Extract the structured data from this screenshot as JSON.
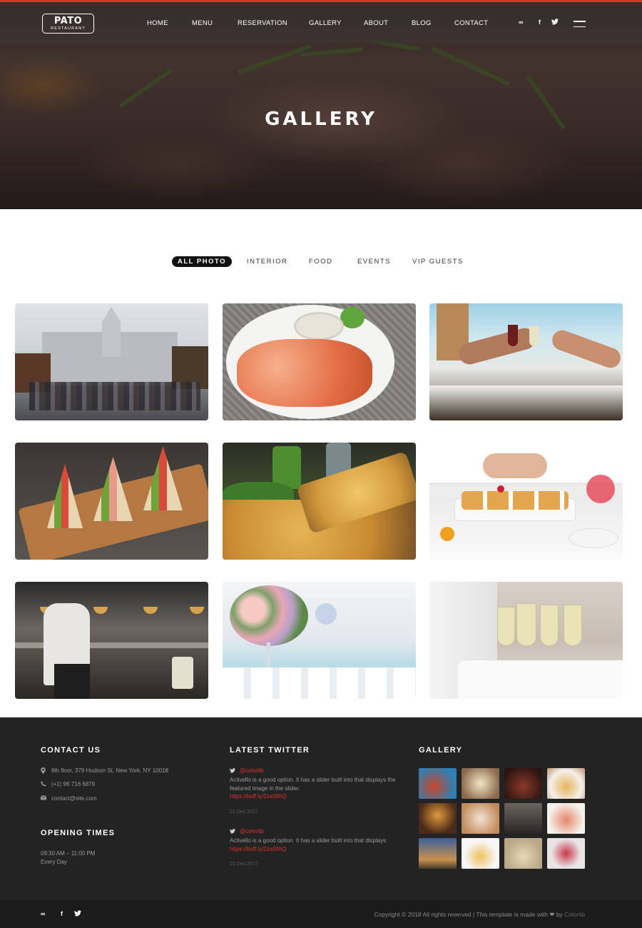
{
  "brand": {
    "name": "PATO",
    "tagline": "RESTAURANT"
  },
  "nav": {
    "items": [
      {
        "label": "HOME"
      },
      {
        "label": "MENU"
      },
      {
        "label": "RESERVATION"
      },
      {
        "label": "GALLERY"
      },
      {
        "label": "ABOUT"
      },
      {
        "label": "BLOG"
      },
      {
        "label": "CONTACT"
      }
    ],
    "social": [
      {
        "icon": "tripadvisor-icon",
        "glyph": "∞"
      },
      {
        "icon": "facebook-icon",
        "glyph": "f"
      },
      {
        "icon": "twitter-icon",
        "glyph": "✓"
      }
    ]
  },
  "hero": {
    "title": "GALLERY"
  },
  "filters": [
    {
      "label": "ALL PHOTO",
      "active": true
    },
    {
      "label": "INTERIOR",
      "active": false
    },
    {
      "label": "FOOD",
      "active": false
    },
    {
      "label": "EVENTS",
      "active": false
    },
    {
      "label": "VIP GUESTS",
      "active": false
    }
  ],
  "gallery": [
    {
      "subject": "christmas-market-street"
    },
    {
      "subject": "grilled-shrimp-plate"
    },
    {
      "subject": "wine-toast-table"
    },
    {
      "subject": "sandwiches-on-board"
    },
    {
      "subject": "pizza-slice"
    },
    {
      "subject": "dessert-tartlets"
    },
    {
      "subject": "chef-in-kitchen"
    },
    {
      "subject": "wedding-flower-centerpiece"
    },
    {
      "subject": "champagne-glasses-tray"
    }
  ],
  "footer": {
    "contact": {
      "heading": "CONTACT US",
      "address": "8th floor, 379 Hudson St, New York, NY 10018",
      "phone": "(+1) 96 716 6879",
      "email": "contact@site.com"
    },
    "opening": {
      "heading": "OPENING TIMES",
      "hours": "09:30 AM – 11:00 PM",
      "days": "Every Day"
    },
    "twitter": {
      "heading": "LATEST TWITTER",
      "tweets": [
        {
          "handle": "@colorlib",
          "text": "Activello is a good option. It has a slider built into that displays the featured image in the slider.",
          "link": "https://buff.ly/2zaSfAQ",
          "date": "21 Dec 2017"
        },
        {
          "handle": "@colorlib",
          "text": "Activello is a good option. It has a slider built into that displays",
          "link": "https://buff.ly/2zaSfAQ",
          "date": "21 Dec 2017"
        }
      ]
    },
    "gallery": {
      "heading": "GALLERY"
    },
    "copyright": {
      "text": "Copyright © 2018 All rights reserved | This template is made with ❤ by",
      "brand": "Colorlib"
    }
  },
  "colors": {
    "accent": "#e0312a",
    "footer_bg": "#232323",
    "footer_bottom_bg": "#1b1b1b"
  }
}
